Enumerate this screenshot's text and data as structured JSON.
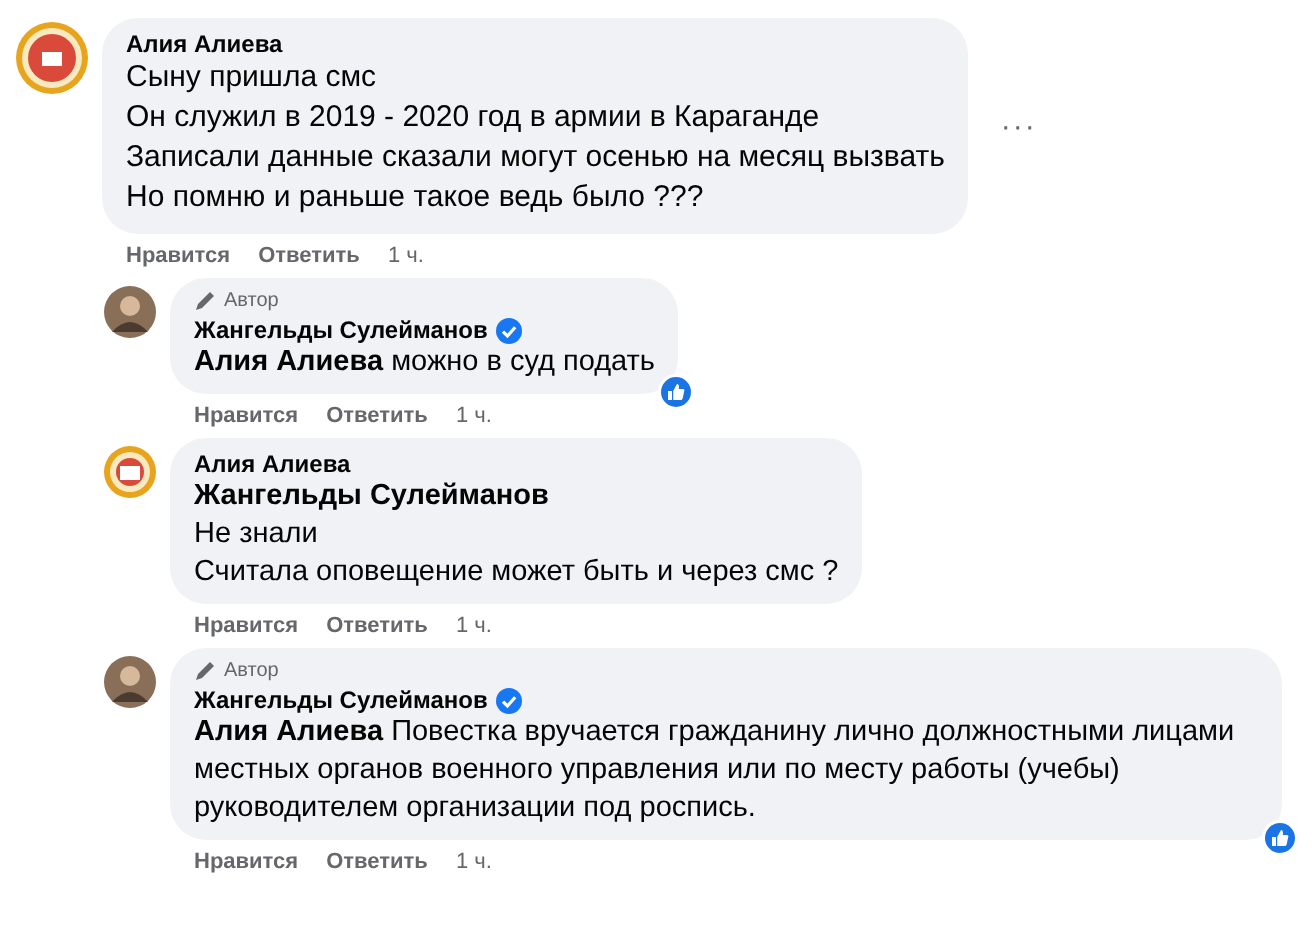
{
  "comments": [
    {
      "kind": "logo",
      "author": "Алия Алиева",
      "lines": [
        "Сыну пришла смс",
        "Он служил в 2019 - 2020 год в армии в Караганде",
        "Записали данные сказали могут осенью на месяц вызвать",
        "Но помню и раньше такое ведь было ???"
      ],
      "more_button": "···",
      "actions": [
        "Нравится",
        "Ответить"
      ],
      "time": "1 ч.",
      "children": [
        {
          "kind": "person",
          "author_badge": "Автор",
          "author": "Жангельды Сулейманов",
          "verified": true,
          "lines": [
            "**Алия Алиева** можно в суд подать"
          ],
          "like_reaction": true,
          "actions": [
            "Нравится",
            "Ответить"
          ],
          "time": "1 ч."
        },
        {
          "kind": "logo",
          "author": "Алия Алиева",
          "lines": [
            "**Жангельды Сулейманов**",
            "Не знали",
            "Считала оповещение может быть и через смс ?"
          ],
          "actions": [
            "Нравится",
            "Ответить"
          ],
          "time": "1 ч."
        },
        {
          "kind": "person",
          "author_badge": "Автор",
          "author": "Жангельды Сулейманов",
          "verified": true,
          "lines": [
            "**Алия Алиева** Повестка вручается гражданину лично должностными лицами местных органов военного управления или по месту работы (учебы) руководителем организации под роспись."
          ],
          "like_reaction": true,
          "actions": [
            "Нравится",
            "Ответить"
          ],
          "time": "1 ч."
        }
      ]
    }
  ]
}
